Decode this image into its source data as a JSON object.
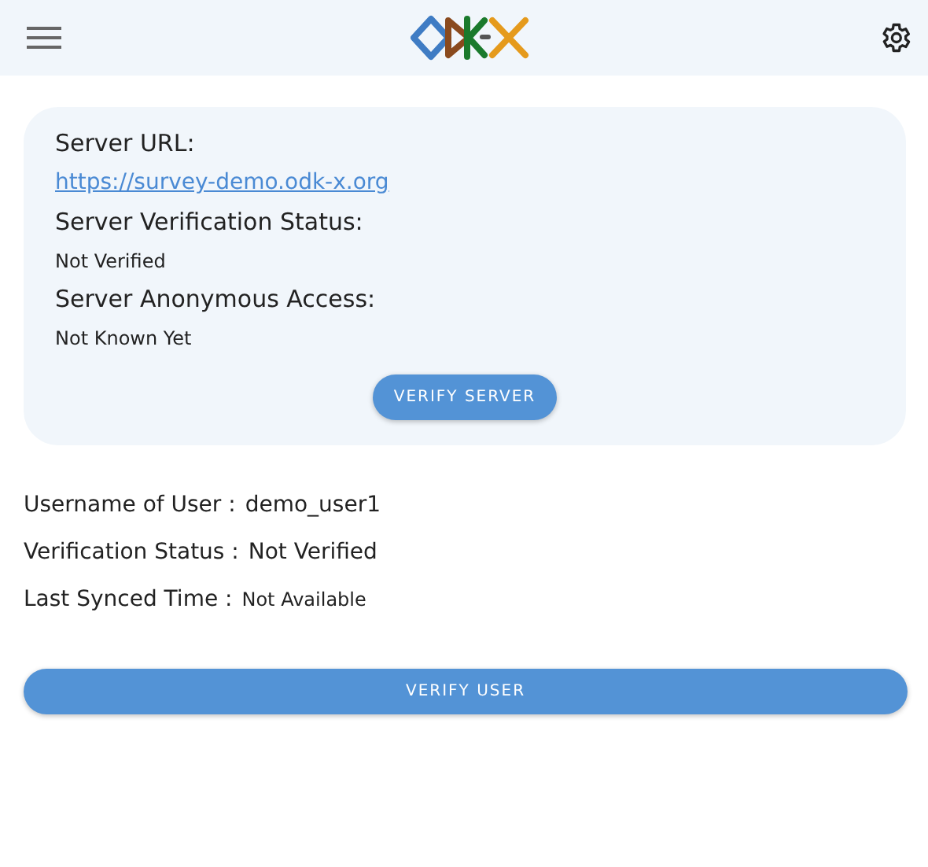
{
  "server_card": {
    "fields": [
      {
        "label": "Server URL:",
        "value": "https://survey-demo.odk-x.org",
        "kind": "link"
      },
      {
        "label": "Server Verification Status:",
        "value": "Not Verified",
        "kind": "text"
      },
      {
        "label": "Server Anonymous Access:",
        "value": "Not Known Yet",
        "kind": "text"
      }
    ],
    "button": "VERIFY SERVER"
  },
  "user_info": [
    {
      "label": "Username of User :",
      "value": "demo_user1",
      "kind": "large"
    },
    {
      "label": "Verification Status :",
      "value": "Not Verified",
      "kind": "large"
    },
    {
      "label": "Last Synced Time :",
      "value": "Not Available",
      "kind": "small"
    }
  ],
  "verify_user_button": "VERIFY USER"
}
